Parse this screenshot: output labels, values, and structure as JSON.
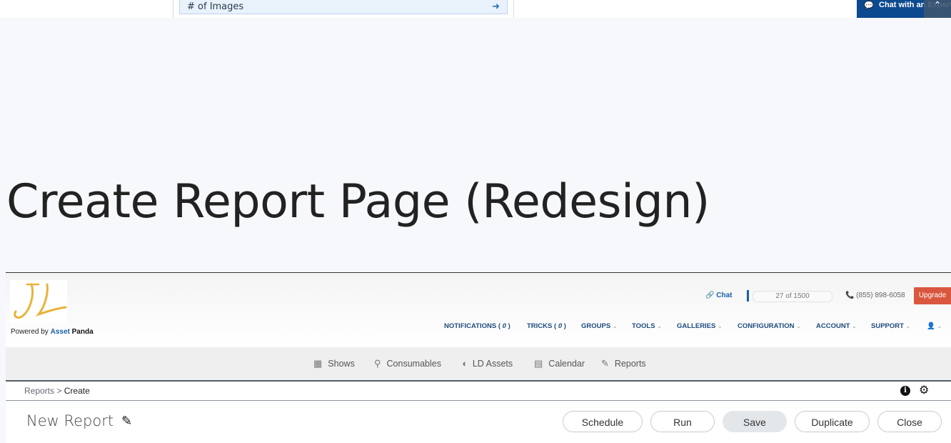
{
  "top_strip": {
    "row_label": "# of Images",
    "row_icon": "arrow-right-icon",
    "chat_expert_label": "Chat with an Expert"
  },
  "page_heading": "Create Report Page (Redesign)",
  "app": {
    "logo_text": "JL",
    "powered_by": "Powered by",
    "brand_first": "Asset",
    "brand_second": "Panda",
    "util": {
      "chat": "Chat",
      "progress": "27 of 1500",
      "progress_fraction": 0.018,
      "phone": "(855) 898-6058",
      "upgrade": "Upgrade"
    },
    "nav": [
      {
        "label": "NOTIFICATIONS (",
        "count": "0",
        "suffix": ")",
        "has_menu": false
      },
      {
        "label": "TRICKS (",
        "count": "0",
        "suffix": ")",
        "has_menu": false
      },
      {
        "label": "GROUPS",
        "has_menu": true
      },
      {
        "label": "TOOLS",
        "has_menu": true
      },
      {
        "label": "GALLERIES",
        "has_menu": true
      },
      {
        "label": "CONFIGURATION",
        "has_menu": true
      },
      {
        "label": "ACCOUNT",
        "has_menu": true
      },
      {
        "label": "SUPPORT",
        "has_menu": true
      }
    ],
    "sub_nav": [
      {
        "label": "Shows",
        "icon": "calendar-grid-icon"
      },
      {
        "label": "Consumables",
        "icon": "map-pin-icon"
      },
      {
        "label": "LD Assets",
        "icon": "tag-icon"
      },
      {
        "label": "Calendar",
        "icon": "calendar-icon"
      },
      {
        "label": "Reports",
        "icon": "edit-report-icon"
      }
    ],
    "breadcrumb": {
      "parent": "Reports",
      "separator": ">",
      "current": "Create"
    },
    "report": {
      "title": "New Report",
      "buttons": {
        "schedule": "Schedule",
        "run": "Run",
        "save": "Save",
        "duplicate": "Duplicate",
        "close": "Close"
      }
    },
    "colors": {
      "nav_text": "#1e4c7e",
      "upgrade": "#d9573f",
      "brand_blue": "#1a5fa8",
      "logo_gold": "#e8b33a"
    }
  }
}
